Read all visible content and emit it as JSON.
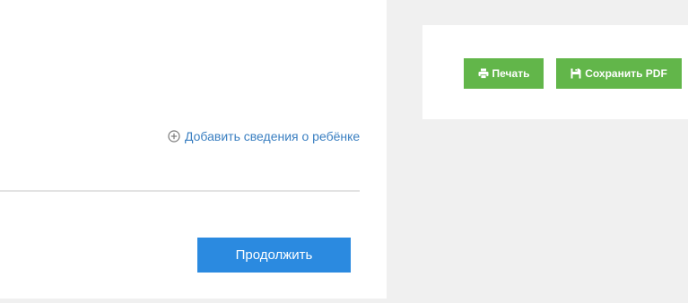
{
  "form": {
    "add_child_label": "Добавить сведения о ребёнке",
    "add_child_icon": "plus-circle-icon",
    "continue_label": "Продолжить"
  },
  "actions": {
    "print_label": "Печать",
    "print_icon": "printer-icon",
    "save_pdf_label": "Сохранить PDF",
    "save_pdf_icon": "save-disk-icon"
  },
  "colors": {
    "link": "#3a7fc1",
    "primary_button": "#2b8ae0",
    "action_button": "#62b64a",
    "page_background": "#f0f0f0",
    "panel_background": "#ffffff"
  }
}
